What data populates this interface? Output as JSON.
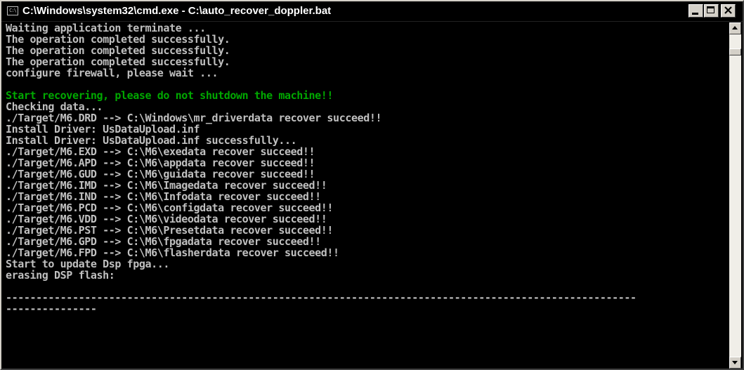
{
  "window": {
    "title": "C:\\Windows\\system32\\cmd.exe - C:\\auto_recover_doppler.bat",
    "icon": "cmd-icon",
    "icon_text": "C:\\",
    "buttons": {
      "minimize": "minimize-icon",
      "maximize": "maximize-icon",
      "close": "close-icon"
    }
  },
  "colors": {
    "console_text": "#c0c0c0",
    "highlight_text": "#00a800",
    "background": "#000000"
  },
  "console": {
    "lines": [
      {
        "text": "Waiting application terminate ...",
        "style": "normal"
      },
      {
        "text": "The operation completed successfully.",
        "style": "normal"
      },
      {
        "text": "The operation completed successfully.",
        "style": "normal"
      },
      {
        "text": "The operation completed successfully.",
        "style": "normal"
      },
      {
        "text": "configure firewall, please wait ...",
        "style": "normal"
      },
      {
        "text": "",
        "style": "normal"
      },
      {
        "text": "Start recovering, please do not shutdown the machine!!",
        "style": "green"
      },
      {
        "text": "Checking data...",
        "style": "normal"
      },
      {
        "text": "./Target/M6.DRD --> C:\\Windows\\mr_driverdata recover succeed!!",
        "style": "normal"
      },
      {
        "text": "Install Driver: UsDataUpload.inf",
        "style": "normal"
      },
      {
        "text": "Install Driver: UsDataUpload.inf successfully...",
        "style": "normal"
      },
      {
        "text": "./Target/M6.EXD --> C:\\M6\\exedata recover succeed!!",
        "style": "normal"
      },
      {
        "text": "./Target/M6.APD --> C:\\M6\\appdata recover succeed!!",
        "style": "normal"
      },
      {
        "text": "./Target/M6.GUD --> C:\\M6\\guidata recover succeed!!",
        "style": "normal"
      },
      {
        "text": "./Target/M6.IMD --> C:\\M6\\Imagedata recover succeed!!",
        "style": "normal"
      },
      {
        "text": "./Target/M6.IND --> C:\\M6\\Infodata recover succeed!!",
        "style": "normal"
      },
      {
        "text": "./Target/M6.PCD --> C:\\M6\\configdata recover succeed!!",
        "style": "normal"
      },
      {
        "text": "./Target/M6.VDD --> C:\\M6\\videodata recover succeed!!",
        "style": "normal"
      },
      {
        "text": "./Target/M6.PST --> C:\\M6\\Presetdata recover succeed!!",
        "style": "normal"
      },
      {
        "text": "./Target/M6.GPD --> C:\\M6\\fpgadata recover succeed!!",
        "style": "normal"
      },
      {
        "text": "./Target/M6.FPD --> C:\\M6\\flasherdata recover succeed!!",
        "style": "normal"
      },
      {
        "text": "Start to update Dsp fpga...",
        "style": "normal"
      },
      {
        "text": "erasing DSP flash:",
        "style": "normal"
      },
      {
        "text": "",
        "style": "normal"
      },
      {
        "text": "--------------------------------------------------------------------------------------------------------",
        "style": "normal"
      },
      {
        "text": "---------------",
        "style": "normal"
      }
    ]
  },
  "scrollbar": {
    "up_icon": "scroll-up-arrow-icon",
    "down_icon": "scroll-down-arrow-icon",
    "position": 0.04
  }
}
